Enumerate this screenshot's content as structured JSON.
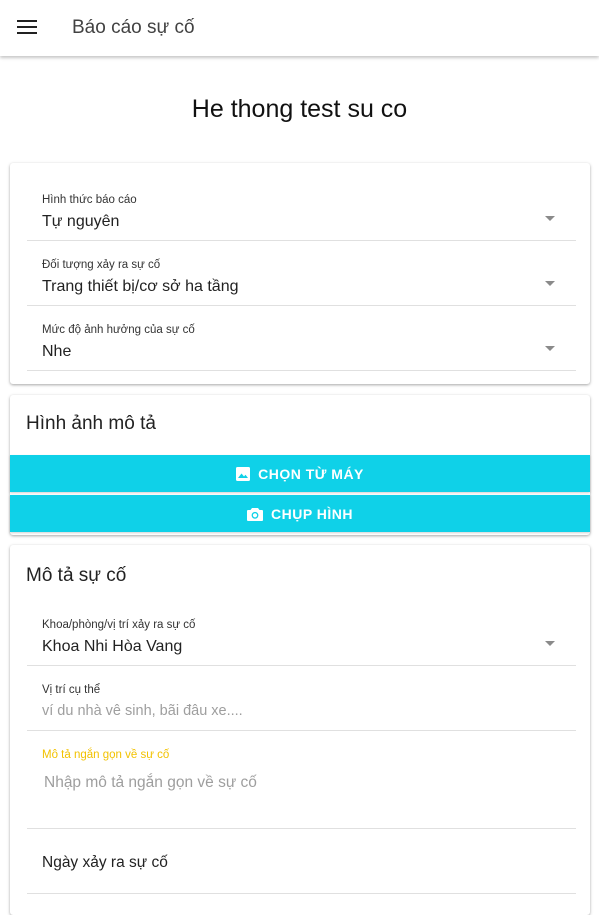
{
  "appbar": {
    "title": "Báo cáo sự cố",
    "menu_icon": "menu-icon"
  },
  "page_title": "He thong test su co",
  "report_card": {
    "fields": [
      {
        "label": "Hình thức báo cáo",
        "value": "Tự nguyên"
      },
      {
        "label": "Đối tượng xảy ra sự cố",
        "value": "Trang thiết bị/cơ sở ha tầng"
      },
      {
        "label": "Mức độ ảnh hưởng của sự cố",
        "value": "Nhe"
      }
    ]
  },
  "image_card": {
    "title": "Hình ảnh mô tả",
    "buttons": [
      {
        "label": "CHỌN TỪ MÁY",
        "icon": "image-icon"
      },
      {
        "label": "CHỤP HÌNH",
        "icon": "camera-icon"
      }
    ],
    "button_color": "#0fd1e8"
  },
  "description_card": {
    "title": "Mô tả sự cố",
    "location_field": {
      "label": "Khoa/phòng/vị trí xảy ra sự cố",
      "value": "Khoa Nhi Hòa Vang"
    },
    "specific_field": {
      "label": "Vị trí cụ thể",
      "placeholder": "ví du nhà vê sinh, bãi đâu xe...."
    },
    "short_desc_field": {
      "label": "Mô tả ngắn gọn về sự cố",
      "placeholder": "Nhập mô tả ngắn gọn về sự cố",
      "label_color": "#f2c200"
    },
    "date_field": {
      "label": "Ngày xảy ra sự cố"
    }
  }
}
